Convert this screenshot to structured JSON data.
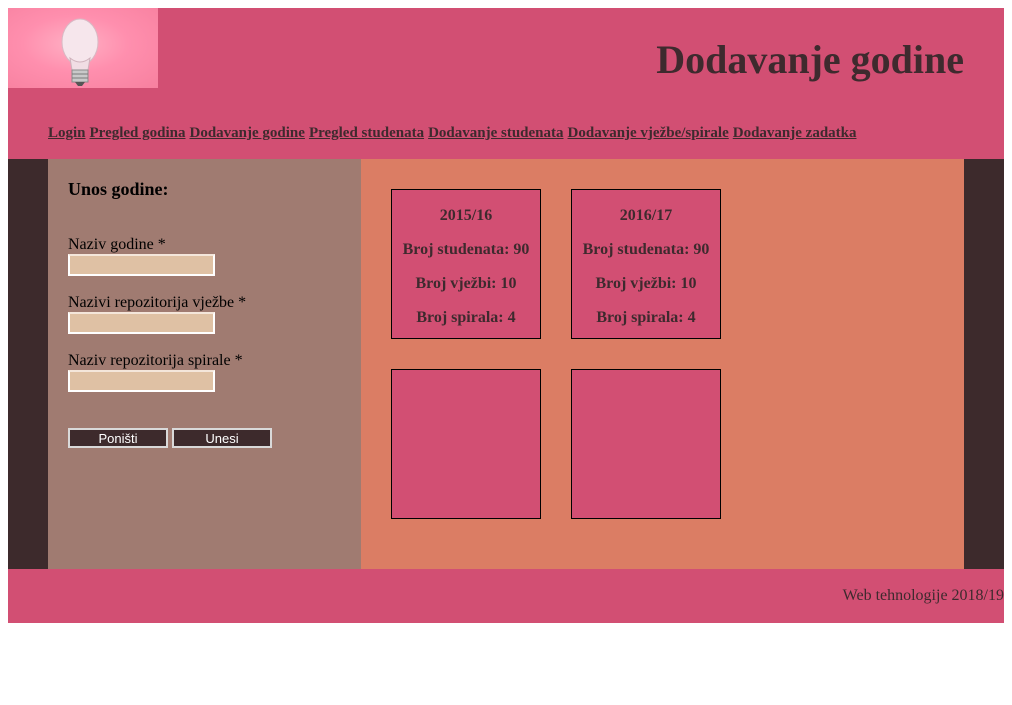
{
  "header": {
    "title": "Dodavanje godine",
    "logo_icon": "lightbulb-icon"
  },
  "nav": {
    "items": [
      "Login",
      "Pregled godina",
      "Dodavanje godine",
      "Pregled studenata",
      "Dodavanje studenata",
      "Dodavanje vježbe/spirale",
      "Dodavanje zadatka"
    ]
  },
  "form": {
    "title": "Unos godine:",
    "fields": [
      {
        "label": "Naziv godine *",
        "value": ""
      },
      {
        "label": "Nazivi repozitorija vježbe *",
        "value": ""
      },
      {
        "label": "Naziv repozitorija spirale *",
        "value": ""
      }
    ],
    "reset_label": "Poništi",
    "submit_label": "Unesi"
  },
  "cards": [
    {
      "year": "2015/16",
      "students": "Broj studenata: 90",
      "exercises": "Broj vježbi: 10",
      "spirals": "Broj spirala: 4"
    },
    {
      "year": "2016/17",
      "students": "Broj studenata: 90",
      "exercises": "Broj vježbi: 10",
      "spirals": "Broj spirala: 4"
    },
    {
      "year": "",
      "students": "",
      "exercises": "",
      "spirals": ""
    },
    {
      "year": "",
      "students": "",
      "exercises": "",
      "spirals": ""
    }
  ],
  "footer": {
    "text": "Web tehnologije 2018/19"
  },
  "colors": {
    "header_bg": "#d24f73",
    "left_panel_bg": "#a07b71",
    "right_panel_bg": "#db7d64",
    "dark_border": "#3d2a2c",
    "input_bg": "#dfc1a4"
  }
}
